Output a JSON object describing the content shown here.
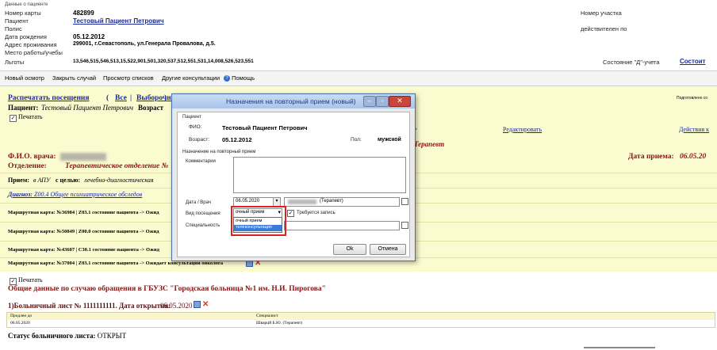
{
  "patient": {
    "section_title": "Данные о пациенте",
    "card_label": "Номер карты",
    "card_value": "482899",
    "patient_label": "Пациент",
    "patient_value": "Тестовый Пациент Петрович",
    "policy_label": "Полис",
    "birth_label": "Дата рождения",
    "birth_value": "05.12.2012",
    "address_label": "Адрес проживания",
    "address_value": "299001, г.Севастополь, ул.Генерала Провалова, д.5.",
    "work_label": "Место работы/учебы",
    "benefits_label": "Льготы",
    "benefits_value": "13,546,515,546,513,15,522,901,501,320,537,512,551,531,14,008,526,523,551",
    "area_label": "Номер участка",
    "valid_label": "действителен по",
    "status_label": "Состояние \"Д\"-учета",
    "status_link": "Состоит"
  },
  "toolbar": {
    "items": [
      "Новый осмотр",
      "Закрыть случай",
      "Просмотр списков",
      "Другие консультации",
      "Помощь"
    ]
  },
  "main": {
    "print_visits": "Распечатать посещения",
    "filter_all": "Все",
    "filter_selected": "Выборочно",
    "right_note": "Подготовлено со",
    "patient_label": "Пациент:",
    "patient_value": "Тестовый Пациент Петрович",
    "age_label": "Возраст",
    "print_label": "Печатать",
    "edit_link": "Редактировать",
    "actions_link": "Действия к",
    "therapist": "Терапевт",
    "doctor_label": "Ф.И.О. врача:",
    "dept_label": "Отделение:",
    "dept_value": "Терапевтическое отделение №",
    "visit_date_label": "Дата приема:",
    "visit_date_value": "06.05.20",
    "reception_label": "Прием:",
    "reception_place": "в АПУ",
    "reception_goal_label": "с целью:",
    "reception_goal": "лечебно-диагностическая",
    "diagnosis_label": "Диагноз:",
    "diagnosis_value": "Z00.4 Общее психиатрическое обследов",
    "route_cards": [
      "Маршрутная карта: №36984 | Z03.1 состояние пациента -> Ожид",
      "Маршрутная карта: №50849 | Z00.0 состояние пациента -> Ожид",
      "Маршрутная карта: №43607 | C30.1 состояние пациента -> Ожид",
      "Маршрутная карта: №37004 | Z03.1 состояние пациента -> Ожидает консультации онколога"
    ]
  },
  "lower": {
    "print_label": "Печатать",
    "general_title": "Общие данные по случаю обращения в ГБУЗС \"Городская больница №1 им. Н.И. Пирогова\"",
    "sick_list_title": "1)Больничный лист № 1111111111. Дата открытия:",
    "sick_list_date": "06.05.2020",
    "table_headers": [
      "Продлен до",
      "Специалист"
    ],
    "table_row": [
      "06.05.2020",
      "Шварцй Б.Ю. (Терапевт)"
    ],
    "status_label": "Статус больничного листа:",
    "status_value": "ОТКРЫТ"
  },
  "dialog": {
    "title": "Назначения на повторный прием (новый)",
    "patient_group": "Пациент",
    "fio_label": "ФИО:",
    "fio_value": "Тестовый Пациент Петрович",
    "age_label": "Возраст:",
    "age_value": "05.12.2012",
    "sex_label": "Пол:",
    "sex_value": "мужской",
    "assign_group": "Назначение на повторный прием",
    "comments_label": "Комментарии",
    "date_doctor_label": "Дата / Врач",
    "date_value": "06.05.2020",
    "doctor_value": "(Терапевт)",
    "visit_type_label": "Вид посещения",
    "visit_type_value": "очный прием",
    "visit_type_options": [
      "очный прием",
      "телеконсультация"
    ],
    "record_required_label": "Требуется запись",
    "specialty_label": "Специальность",
    "ok_label": "Ok",
    "cancel_label": "Отмена"
  },
  "colors": {
    "yellow_bg": "#fbfbd0",
    "maroon": "#8a1414",
    "link": "#1a2a9a",
    "highlight": "#e02020",
    "title_blue": "#1a3c7a"
  }
}
